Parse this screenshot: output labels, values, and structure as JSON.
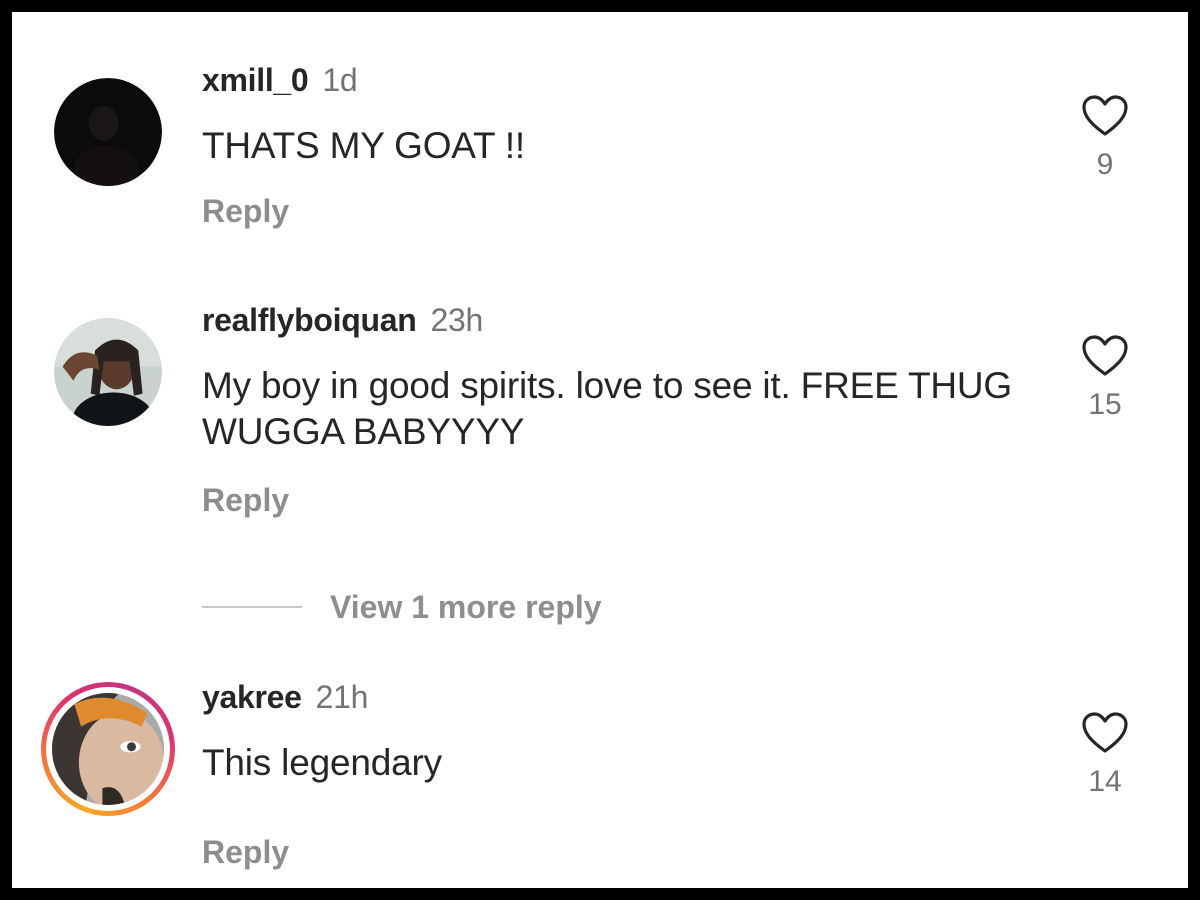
{
  "comments": [
    {
      "username": "xmill_0",
      "time": "1d",
      "text": "THATS MY GOAT !!",
      "reply_label": "Reply",
      "likes": "9",
      "avatar_icon": "dark-avatar",
      "has_story_ring": false
    },
    {
      "username": "realflyboiquan",
      "time": "23h",
      "text": "My boy in good spirits. love to see it. FREE THUG WUGGA BABYYYY",
      "reply_label": "Reply",
      "likes": "15",
      "avatar_icon": "person-photo-avatar",
      "has_story_ring": false
    },
    {
      "username": "yakree",
      "time": "21h",
      "text": "This legendary",
      "reply_label": "Reply",
      "likes": "14",
      "avatar_icon": "person-photo-avatar",
      "has_story_ring": true
    }
  ],
  "view_more_replies": "View 1 more reply",
  "colors": {
    "text_primary": "#262626",
    "text_secondary": "#8e8e8e",
    "background": "#ffffff",
    "frame_border": "#000000"
  }
}
